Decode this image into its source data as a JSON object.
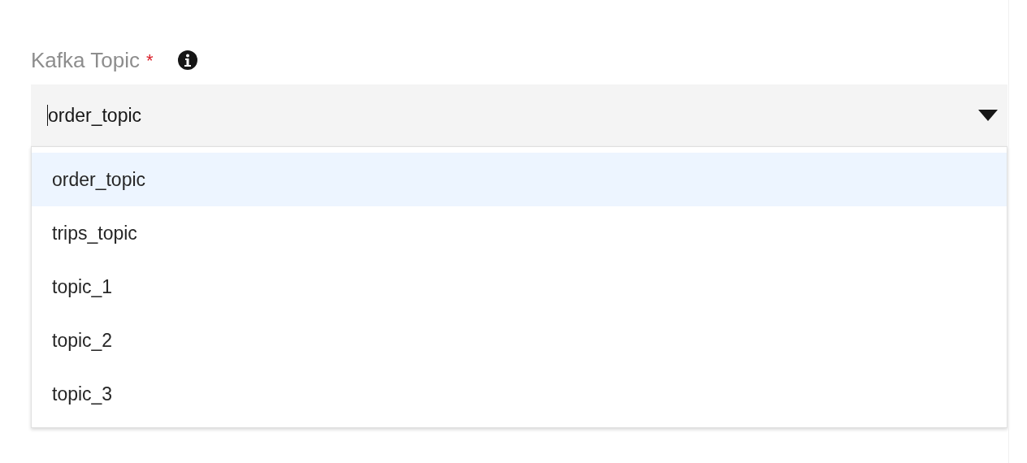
{
  "field": {
    "label": "Kafka Topic",
    "required_mark": "*",
    "value": "order_topic",
    "expanded": true
  },
  "options": [
    {
      "label": "order_topic",
      "selected": true
    },
    {
      "label": "trips_topic",
      "selected": false
    },
    {
      "label": "topic_1",
      "selected": false
    },
    {
      "label": "topic_2",
      "selected": false
    },
    {
      "label": "topic_3",
      "selected": false
    }
  ]
}
